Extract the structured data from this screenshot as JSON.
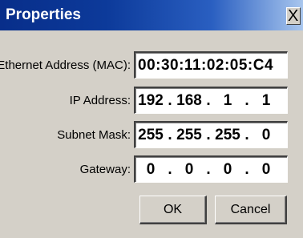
{
  "window": {
    "title": "Properties",
    "close_label": "X"
  },
  "fields": {
    "mac": {
      "label": "Ethernet Address (MAC):",
      "value": "00:30:11:02:05:C4"
    },
    "ip": {
      "label": "IP Address:",
      "octets": [
        "192",
        "168",
        "1",
        "1"
      ]
    },
    "subnet": {
      "label": "Subnet Mask:",
      "octets": [
        "255",
        "255",
        "255",
        "0"
      ]
    },
    "gateway": {
      "label": "Gateway:",
      "octets": [
        "0",
        "0",
        "0",
        "0"
      ]
    }
  },
  "buttons": {
    "ok": "OK",
    "cancel": "Cancel"
  },
  "separator": "."
}
